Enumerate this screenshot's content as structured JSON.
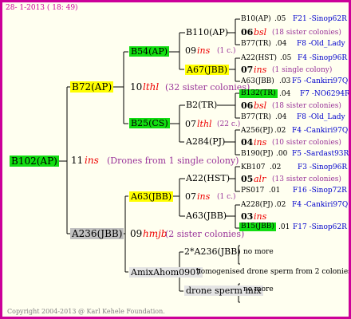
{
  "header": {
    "date_line": "28-  1-2013 ( 18: 49)"
  },
  "root": {
    "id": "B102(AP)",
    "gen": "11",
    "breeder": "ins",
    "note": "(Drones from 1 single colony)"
  },
  "mother": {
    "id": "B72(AP)",
    "gen": "10",
    "breeder": "lthl",
    "note": "(32 sister colonies)"
  },
  "father": {
    "id": "A236(JBB)",
    "gen": "09",
    "breeder": "hmjb",
    "note": "(2 sister colonies)"
  },
  "gm_m": {
    "id": "B54(AP)",
    "gen": "09",
    "breeder": "ins",
    "note": "(1 c.)"
  },
  "gm_f": {
    "id": "B25(CS)",
    "gen": "07",
    "breeder": "lthl",
    "note": "(22 c.)"
  },
  "gf_m": {
    "id": "A63(JBB)",
    "gen": "07",
    "breeder": "ins",
    "note": "(1 c.)"
  },
  "gf_f": {
    "id": "AmixAhom0907",
    "note": "homogenised drone sperm from 2 colonies"
  },
  "ggm1": {
    "id": "B110(AP)"
  },
  "ggf1": {
    "id": "A67(JBB)"
  },
  "ggm2": {
    "id": "B2(TR)"
  },
  "ggf2": {
    "id": "A284(PJ)"
  },
  "ggm3": {
    "id": "A22(HST)"
  },
  "ggf3": {
    "id": "A63(JBB)"
  },
  "ggm4": {
    "id": "2*A236(JBB)",
    "note": "no more"
  },
  "ggf4": {
    "id": "drone sperm mix",
    "note": "no more"
  },
  "rows": [
    {
      "id": "B10(AP)",
      "gen": ".05",
      "code": "F21 -Sinop62R"
    },
    {
      "gen": "06",
      "breeder": "bsl",
      "note": "(18 sister colonies)"
    },
    {
      "id": "B77(TR)",
      "gen": ".04",
      "code": "F8 -Old_Lady"
    },
    {
      "id": "A22(HST)",
      "gen": ".05",
      "code": "F4 -Sinop96R"
    },
    {
      "gen": "07",
      "breeder": "ins",
      "note": "(1 single colony)"
    },
    {
      "id": "A63(JBB)",
      "gen": ".03",
      "code": "F5 -Cankiri97Q"
    },
    {
      "id": "B132(TR)",
      "gen": ".04",
      "code": "F7 -NO6294R"
    },
    {
      "gen": "06",
      "breeder": "bsl",
      "note": "(18 sister colonies)"
    },
    {
      "id": "B77(TR)",
      "gen": ".04",
      "code": "F8 -Old_Lady"
    },
    {
      "id": "A256(PJ)",
      "gen": ".02",
      "code": "F4 -Cankiri97Q"
    },
    {
      "gen": "04",
      "breeder": "ins",
      "note": "(10 sister colonies)"
    },
    {
      "id": "B190(PJ)",
      "gen": ".00",
      "code": "F5 -Sardast93R"
    },
    {
      "id": "KB107",
      "gen": ".02",
      "code": "F3 -Sinop96R"
    },
    {
      "gen": "05",
      "breeder": "alr",
      "note": "(13 sister colonies)"
    },
    {
      "id": "PS017",
      "gen": ".01",
      "code": "F16 -Sinop72R"
    },
    {
      "id": "A228(PJ)",
      "gen": ".02",
      "code": "F4 -Cankiri97Q"
    },
    {
      "gen": "03",
      "breeder": "ins",
      "note": ""
    },
    {
      "id": "B15(JBB)",
      "gen": ".01",
      "code": "F17 -Sinop62R"
    }
  ],
  "footer": {
    "copyright": "Copyright 2004-2013 @ Karl Kehele Foundation."
  }
}
